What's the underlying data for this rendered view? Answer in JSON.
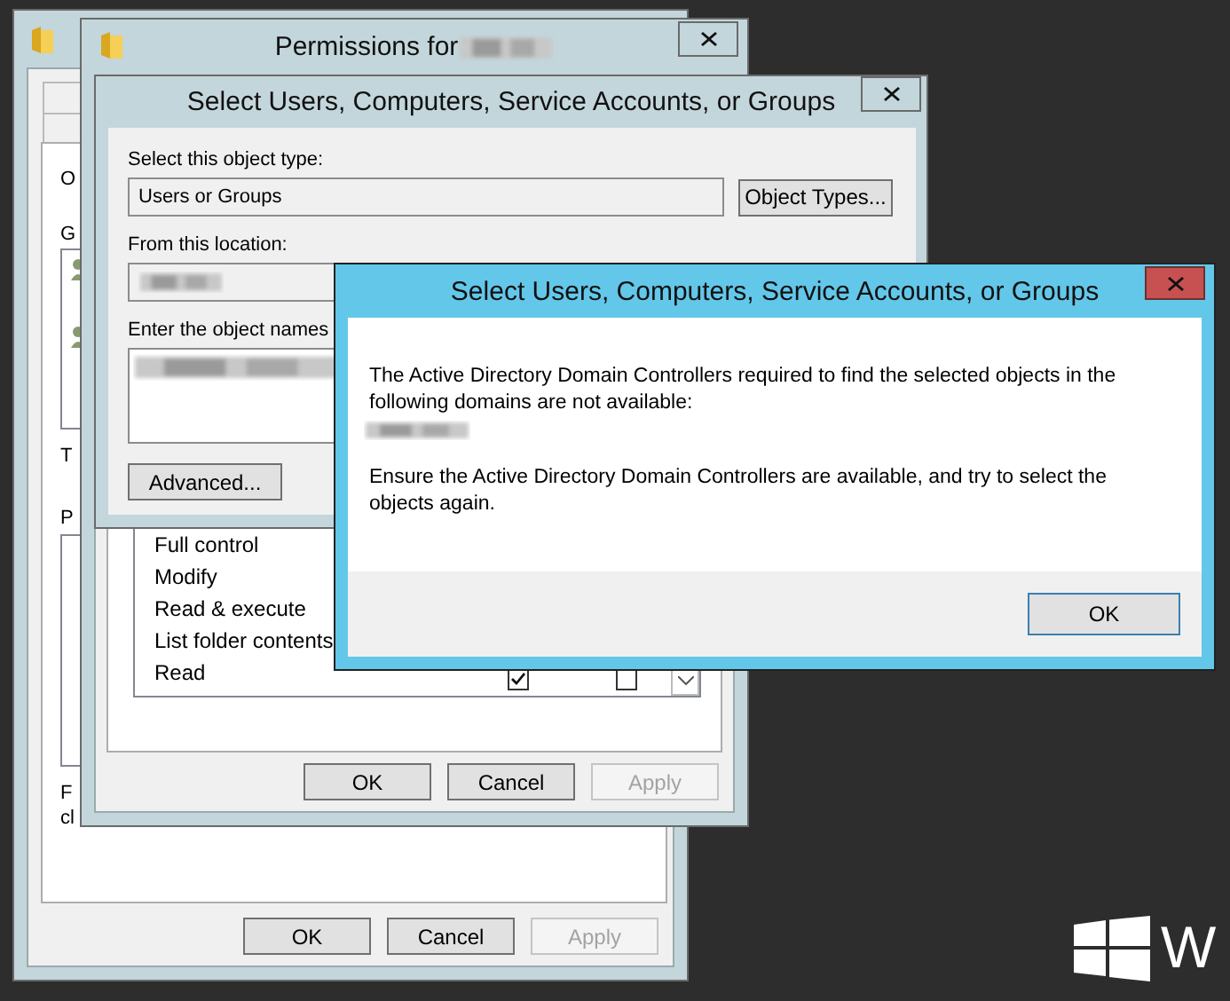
{
  "properties_window": {
    "labels": [
      "O",
      "G",
      "T",
      "P",
      "F",
      "cl"
    ],
    "buttons": [
      {
        "label": "OK",
        "disabled": false
      },
      {
        "label": "Cancel",
        "disabled": false
      },
      {
        "label": "Apply",
        "disabled": true
      }
    ]
  },
  "permissions_window": {
    "title": "Permissions for",
    "permissions": [
      {
        "name": "Full control"
      },
      {
        "name": "Modify"
      },
      {
        "name": "Read & execute"
      },
      {
        "name": "List folder contents"
      },
      {
        "name": "Read",
        "checkboxes": [
          {
            "checked": true
          },
          {
            "checked": false
          }
        ]
      }
    ],
    "buttons": [
      {
        "label": "OK",
        "disabled": false
      },
      {
        "label": "Cancel",
        "disabled": false
      },
      {
        "label": "Apply",
        "disabled": true
      }
    ]
  },
  "select_window": {
    "title": "Select Users, Computers, Service Accounts, or Groups",
    "object_type_label": "Select this object type:",
    "object_type_value": "Users or Groups",
    "object_types_button": "Object Types...",
    "location_label": "From this location:",
    "names_label": "Enter the object names",
    "advanced_button": "Advanced..."
  },
  "error_dialog": {
    "title": "Select Users, Computers, Service Accounts, or Groups",
    "messages": [
      "The Active Directory Domain Controllers required to find the selected objects in the following domains are not available:",
      "Ensure the Active Directory Domain Controllers are available, and try to select the objects again."
    ],
    "button": "OK"
  },
  "os_logo": {
    "text": "W"
  }
}
